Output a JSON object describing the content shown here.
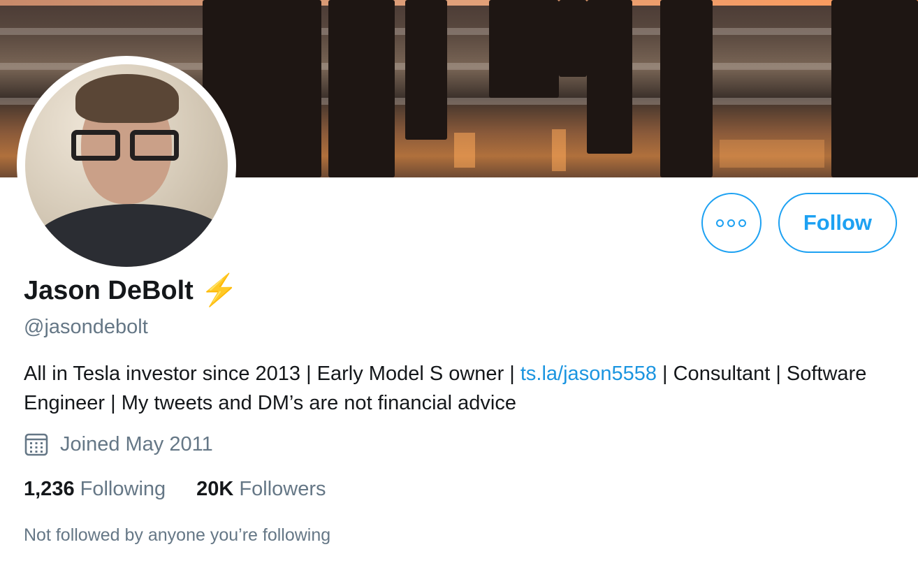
{
  "profile": {
    "name": "Jason DeBolt",
    "badge": "⚡",
    "handle": "@jasondebolt",
    "bio_before_link": "All in Tesla investor since 2013 | Early Model S owner | ",
    "bio_link": "ts.la/jason5558",
    "bio_after_link": " | Consultant | Software Engineer | My tweets and DM’s are not financial advice",
    "joined": "Joined May 2011",
    "following_count": "1,236",
    "following_label": "Following",
    "followers_count": "20K",
    "followers_label": "Followers",
    "followed_by_note": "Not followed by anyone you’re following"
  },
  "actions": {
    "follow_label": "Follow",
    "more_icon": "more-dots-icon"
  },
  "colors": {
    "accent": "#1da1f2",
    "link": "#1b95e0",
    "secondary_text": "#657786",
    "primary_text": "#14171a"
  }
}
